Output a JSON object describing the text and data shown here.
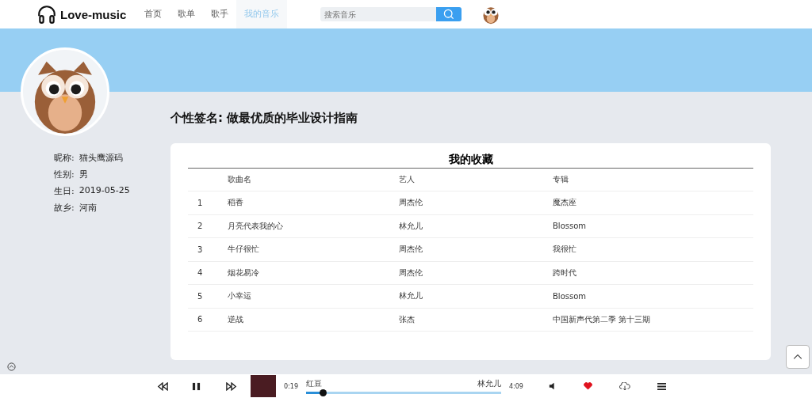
{
  "header": {
    "logo": "Love-music",
    "nav": [
      {
        "label": "首页",
        "selected": false
      },
      {
        "label": "歌单",
        "selected": false
      },
      {
        "label": "歌手",
        "selected": false
      },
      {
        "label": "我的音乐",
        "selected": true
      }
    ],
    "search": {
      "placeholder": "搜索音乐"
    }
  },
  "profile": {
    "signature": "个性签名: 做最优质的毕业设计指南",
    "fields": [
      {
        "label": "昵称:",
        "value": "猫头鹰源码"
      },
      {
        "label": "性别:",
        "value": "男"
      },
      {
        "label": "生日:",
        "value": "2019-05-25"
      },
      {
        "label": "故乡:",
        "value": "河南"
      }
    ]
  },
  "favorites": {
    "title": "我的收藏",
    "columns": [
      "歌曲名",
      "艺人",
      "专辑"
    ],
    "rows": [
      {
        "index": "1",
        "song": "稻香",
        "artist": "周杰伦",
        "album": "魔杰座"
      },
      {
        "index": "2",
        "song": "月亮代表我的心",
        "artist": "林允儿",
        "album": "Blossom"
      },
      {
        "index": "3",
        "song": "牛仔很忙",
        "artist": "周杰伦",
        "album": "我很忙"
      },
      {
        "index": "4",
        "song": "烟花易冷",
        "artist": "周杰伦",
        "album": "跨时代"
      },
      {
        "index": "5",
        "song": "小幸运",
        "artist": "林允儿",
        "album": "Blossom"
      },
      {
        "index": "6",
        "song": "逆战",
        "artist": "张杰",
        "album": "中国新声代第二季 第十三期"
      }
    ]
  },
  "player": {
    "playing": true,
    "elapsed": "0:19",
    "title": "红豆",
    "artist": "林允儿",
    "duration": "4:09",
    "level": 0.09,
    "liked": true
  }
}
